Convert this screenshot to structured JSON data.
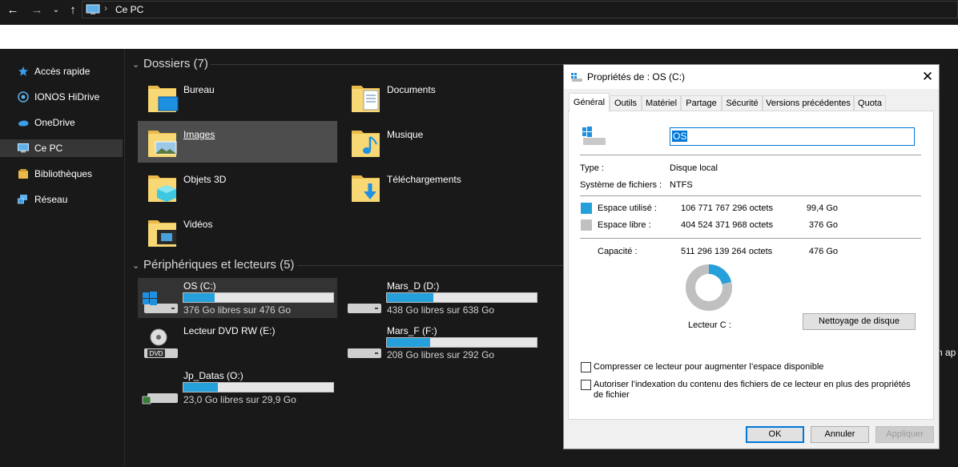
{
  "address": {
    "location": "Ce PC"
  },
  "sidebar": {
    "items": [
      {
        "label": "Accès rapide",
        "icon": "star-icon"
      },
      {
        "label": "IONOS HiDrive",
        "icon": "hidrive-icon"
      },
      {
        "label": "OneDrive",
        "icon": "cloud-icon"
      },
      {
        "label": "Ce PC",
        "icon": "computer-icon",
        "selected": true
      },
      {
        "label": "Bibliothèques",
        "icon": "library-icon"
      },
      {
        "label": "Réseau",
        "icon": "network-icon"
      }
    ]
  },
  "folders_group": {
    "title": "Dossiers (7)"
  },
  "folders": [
    {
      "label": "Bureau",
      "icon": "desktop-folder-icon"
    },
    {
      "label": "Documents",
      "icon": "documents-folder-icon"
    },
    {
      "label": "Images",
      "icon": "pictures-folder-icon",
      "selected": true
    },
    {
      "label": "Musique",
      "icon": "music-folder-icon"
    },
    {
      "label": "Objets 3D",
      "icon": "3d-objects-folder-icon"
    },
    {
      "label": "Téléchargements",
      "icon": "downloads-folder-icon"
    },
    {
      "label": "Vidéos",
      "icon": "videos-folder-icon"
    }
  ],
  "drives_group": {
    "title": "Périphériques et lecteurs (5)"
  },
  "drives": [
    {
      "name": "OS (C:)",
      "free_text": "376 Go libres sur 476 Go",
      "used_fraction": 0.21,
      "selected": true,
      "icon": "windows-drive-icon"
    },
    {
      "name": "Mars_D (D:)",
      "free_text": "438 Go libres sur 638 Go",
      "used_fraction": 0.31,
      "icon": "hard-drive-icon"
    },
    {
      "name": "Lecteur DVD RW (E:)",
      "icon": "dvd-drive-icon"
    },
    {
      "name": "Mars_F (F:)",
      "free_text": "208 Go libres sur 292 Go",
      "used_fraction": 0.29,
      "icon": "hard-drive-icon"
    },
    {
      "name": "Jp_Datas (O:)",
      "free_text": "23,0 Go libres sur 29,9 Go",
      "used_fraction": 0.23,
      "icon": "network-drive-icon"
    }
  ],
  "clipped_text": "n ap",
  "dialog": {
    "title": "Propriétés de : OS (C:)",
    "tabs": [
      "Général",
      "Outils",
      "Matériel",
      "Partage",
      "Sécurité",
      "Versions précédentes",
      "Quota"
    ],
    "active_tab": "Général",
    "name_value": "OS",
    "type_label": "Type :",
    "type_value": "Disque local",
    "fs_label": "Système de fichiers :",
    "fs_value": "NTFS",
    "used": {
      "label": "Espace utilisé :",
      "bytes": "106 771 767 296 octets",
      "size": "99,4 Go",
      "color": "#26a0da"
    },
    "free": {
      "label": "Espace libre :",
      "bytes": "404 524 371 968 octets",
      "size": "376 Go",
      "color": "#c0c0c0"
    },
    "capacity": {
      "label": "Capacité :",
      "bytes": "511 296 139 264 octets",
      "size": "476 Go"
    },
    "used_fraction": 0.209,
    "drive_label": "Lecteur C :",
    "cleanup_button": "Nettoyage de disque",
    "compress_label": "Compresser ce lecteur pour augmenter l’espace disponible",
    "index_label": "Autoriser l’indexation du contenu des fichiers de ce lecteur en plus des propriétés de fichier",
    "ok_button": "OK",
    "cancel_button": "Annuler",
    "apply_button": "Appliquer"
  }
}
